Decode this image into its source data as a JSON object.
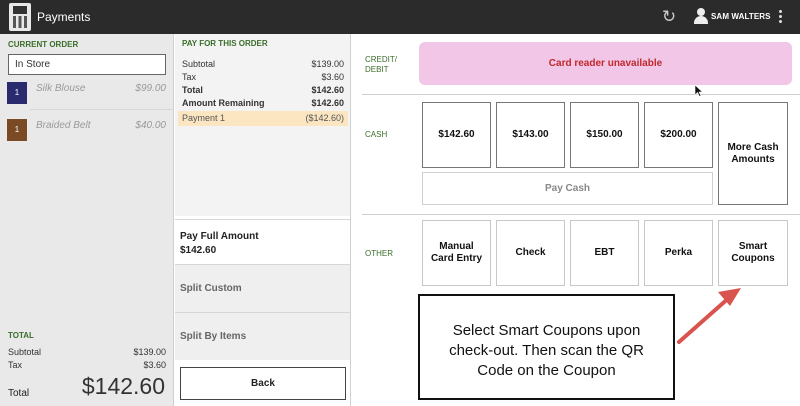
{
  "topbar": {
    "title": "Payments",
    "app_icon": "card-terminal-icon",
    "refresh_icon": "refresh-icon",
    "user_icon": "user-icon",
    "user_name": "SAM WALTERS",
    "menu_icon": "more-vert-icon"
  },
  "current_order": {
    "label": "CURRENT ORDER",
    "store_value": "In Store",
    "items": [
      {
        "qty": "1",
        "name": "Silk Blouse",
        "price": "$99.00",
        "color": "#2a2a6e"
      },
      {
        "qty": "1",
        "name": "Braided Belt",
        "price": "$40.00",
        "color": "#7a4a24"
      }
    ]
  },
  "left_totals": {
    "label": "TOTAL",
    "subtotal_label": "Subtotal",
    "subtotal": "$139.00",
    "tax_label": "Tax",
    "tax": "$3.60",
    "total_label": "Total",
    "total": "$142.60"
  },
  "pay_for_order": {
    "label": "PAY FOR THIS ORDER",
    "subtotal_label": "Subtotal",
    "subtotal": "$139.00",
    "tax_label": "Tax",
    "tax": "$3.60",
    "total_label": "Total",
    "total": "$142.60",
    "remaining_label": "Amount Remaining",
    "remaining": "$142.60",
    "payment_label": "Payment 1",
    "payment_value": "($142.60)"
  },
  "options": {
    "full_line1": "Pay Full Amount",
    "full_line2": "$142.60",
    "split_custom": "Split Custom",
    "split_items": "Split By Items",
    "back": "Back"
  },
  "credit": {
    "label_line1": "CREDIT/",
    "label_line2": "DEBIT",
    "status": "Card reader unavailable",
    "status_bg": "#f1c6e6",
    "status_color": "#c0282c"
  },
  "cash": {
    "label": "CASH",
    "amounts": [
      "$142.60",
      "$143.00",
      "$150.00",
      "$200.00"
    ],
    "more_line1": "More Cash",
    "more_line2": "Amounts",
    "pay_cash": "Pay Cash"
  },
  "other": {
    "label": "OTHER",
    "manual_line1": "Manual",
    "manual_line2": "Card Entry",
    "check": "Check",
    "ebt": "EBT",
    "perka": "Perka",
    "smart_line1": "Smart",
    "smart_line2": "Coupons"
  },
  "annotation": {
    "line1": "Select Smart Coupons upon",
    "line2": "check-out. Then scan the QR",
    "line3": "Code on the Coupon",
    "arrow_color": "#d9534f"
  },
  "accent_green": "#3a6e2a"
}
